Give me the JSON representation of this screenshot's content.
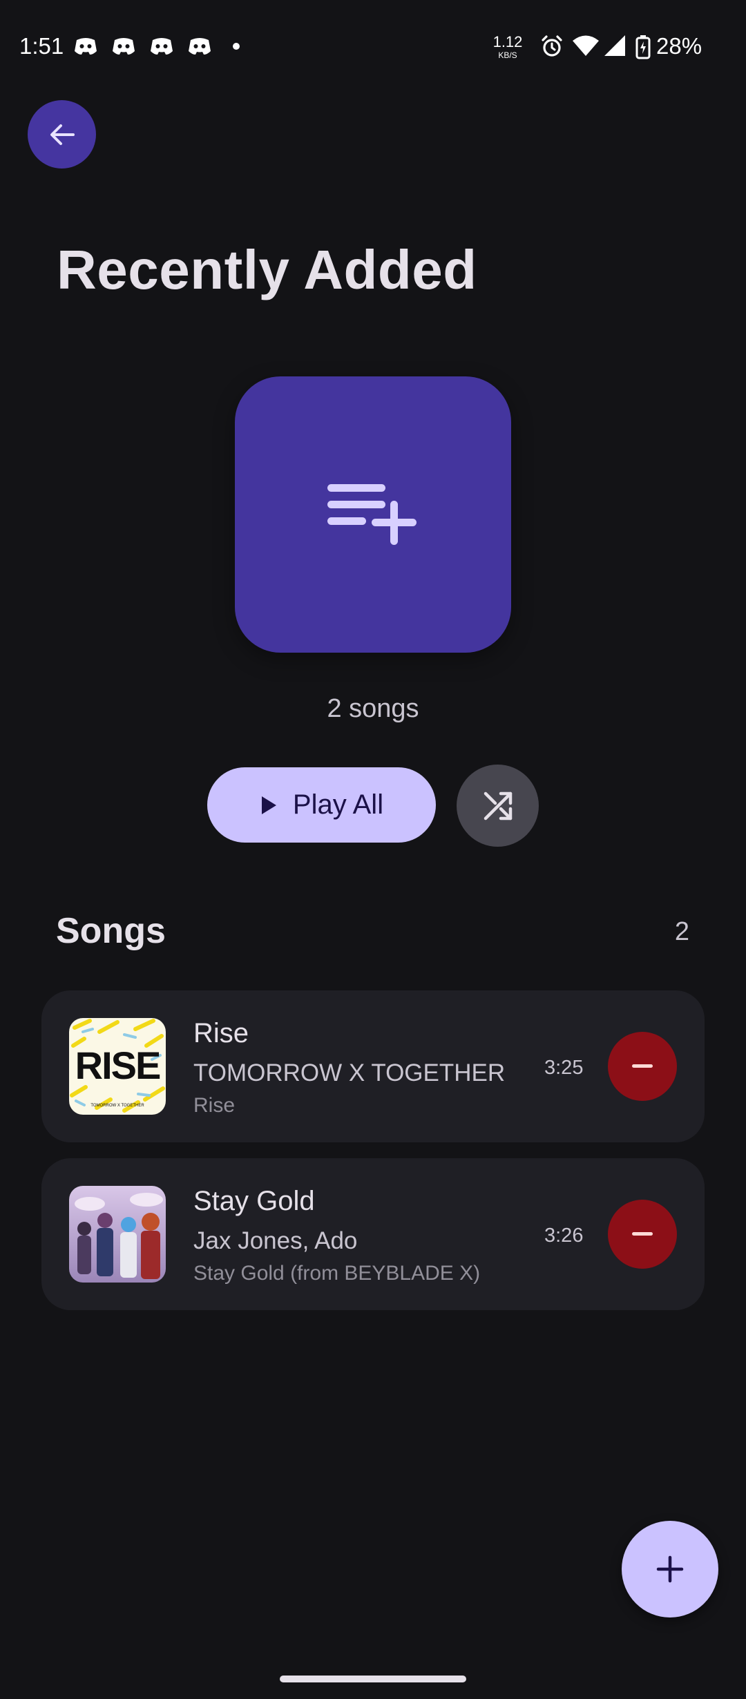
{
  "status_bar": {
    "time": "1:51",
    "net_speed_value": "1.12",
    "net_speed_unit": "KB/S",
    "battery": "28%"
  },
  "header": {
    "title": "Recently Added"
  },
  "playlist": {
    "song_count_label": "2 songs",
    "play_all_label": "Play All"
  },
  "songs_section": {
    "title": "Songs",
    "count": "2"
  },
  "songs": [
    {
      "title": "Rise",
      "artist": "TOMORROW X TOGETHER",
      "album": "Rise",
      "duration": "3:25",
      "art_text": "RISE",
      "art_caption": "TOMORROW X TOGETHER"
    },
    {
      "title": "Stay Gold",
      "artist": "Jax Jones, Ado",
      "album": "Stay Gold (from BEYBLADE X)",
      "duration": "3:26"
    }
  ],
  "colors": {
    "background": "#131316",
    "accent_container": "#44359e",
    "primary_light": "#cbc2ff",
    "remove_red": "#8c0f17",
    "card": "#1f1f25"
  },
  "icons": {
    "back": "arrow-left-icon",
    "playlist_add": "playlist-add-icon",
    "play": "play-icon",
    "shuffle": "shuffle-icon",
    "remove": "minus-icon",
    "add": "plus-icon"
  }
}
